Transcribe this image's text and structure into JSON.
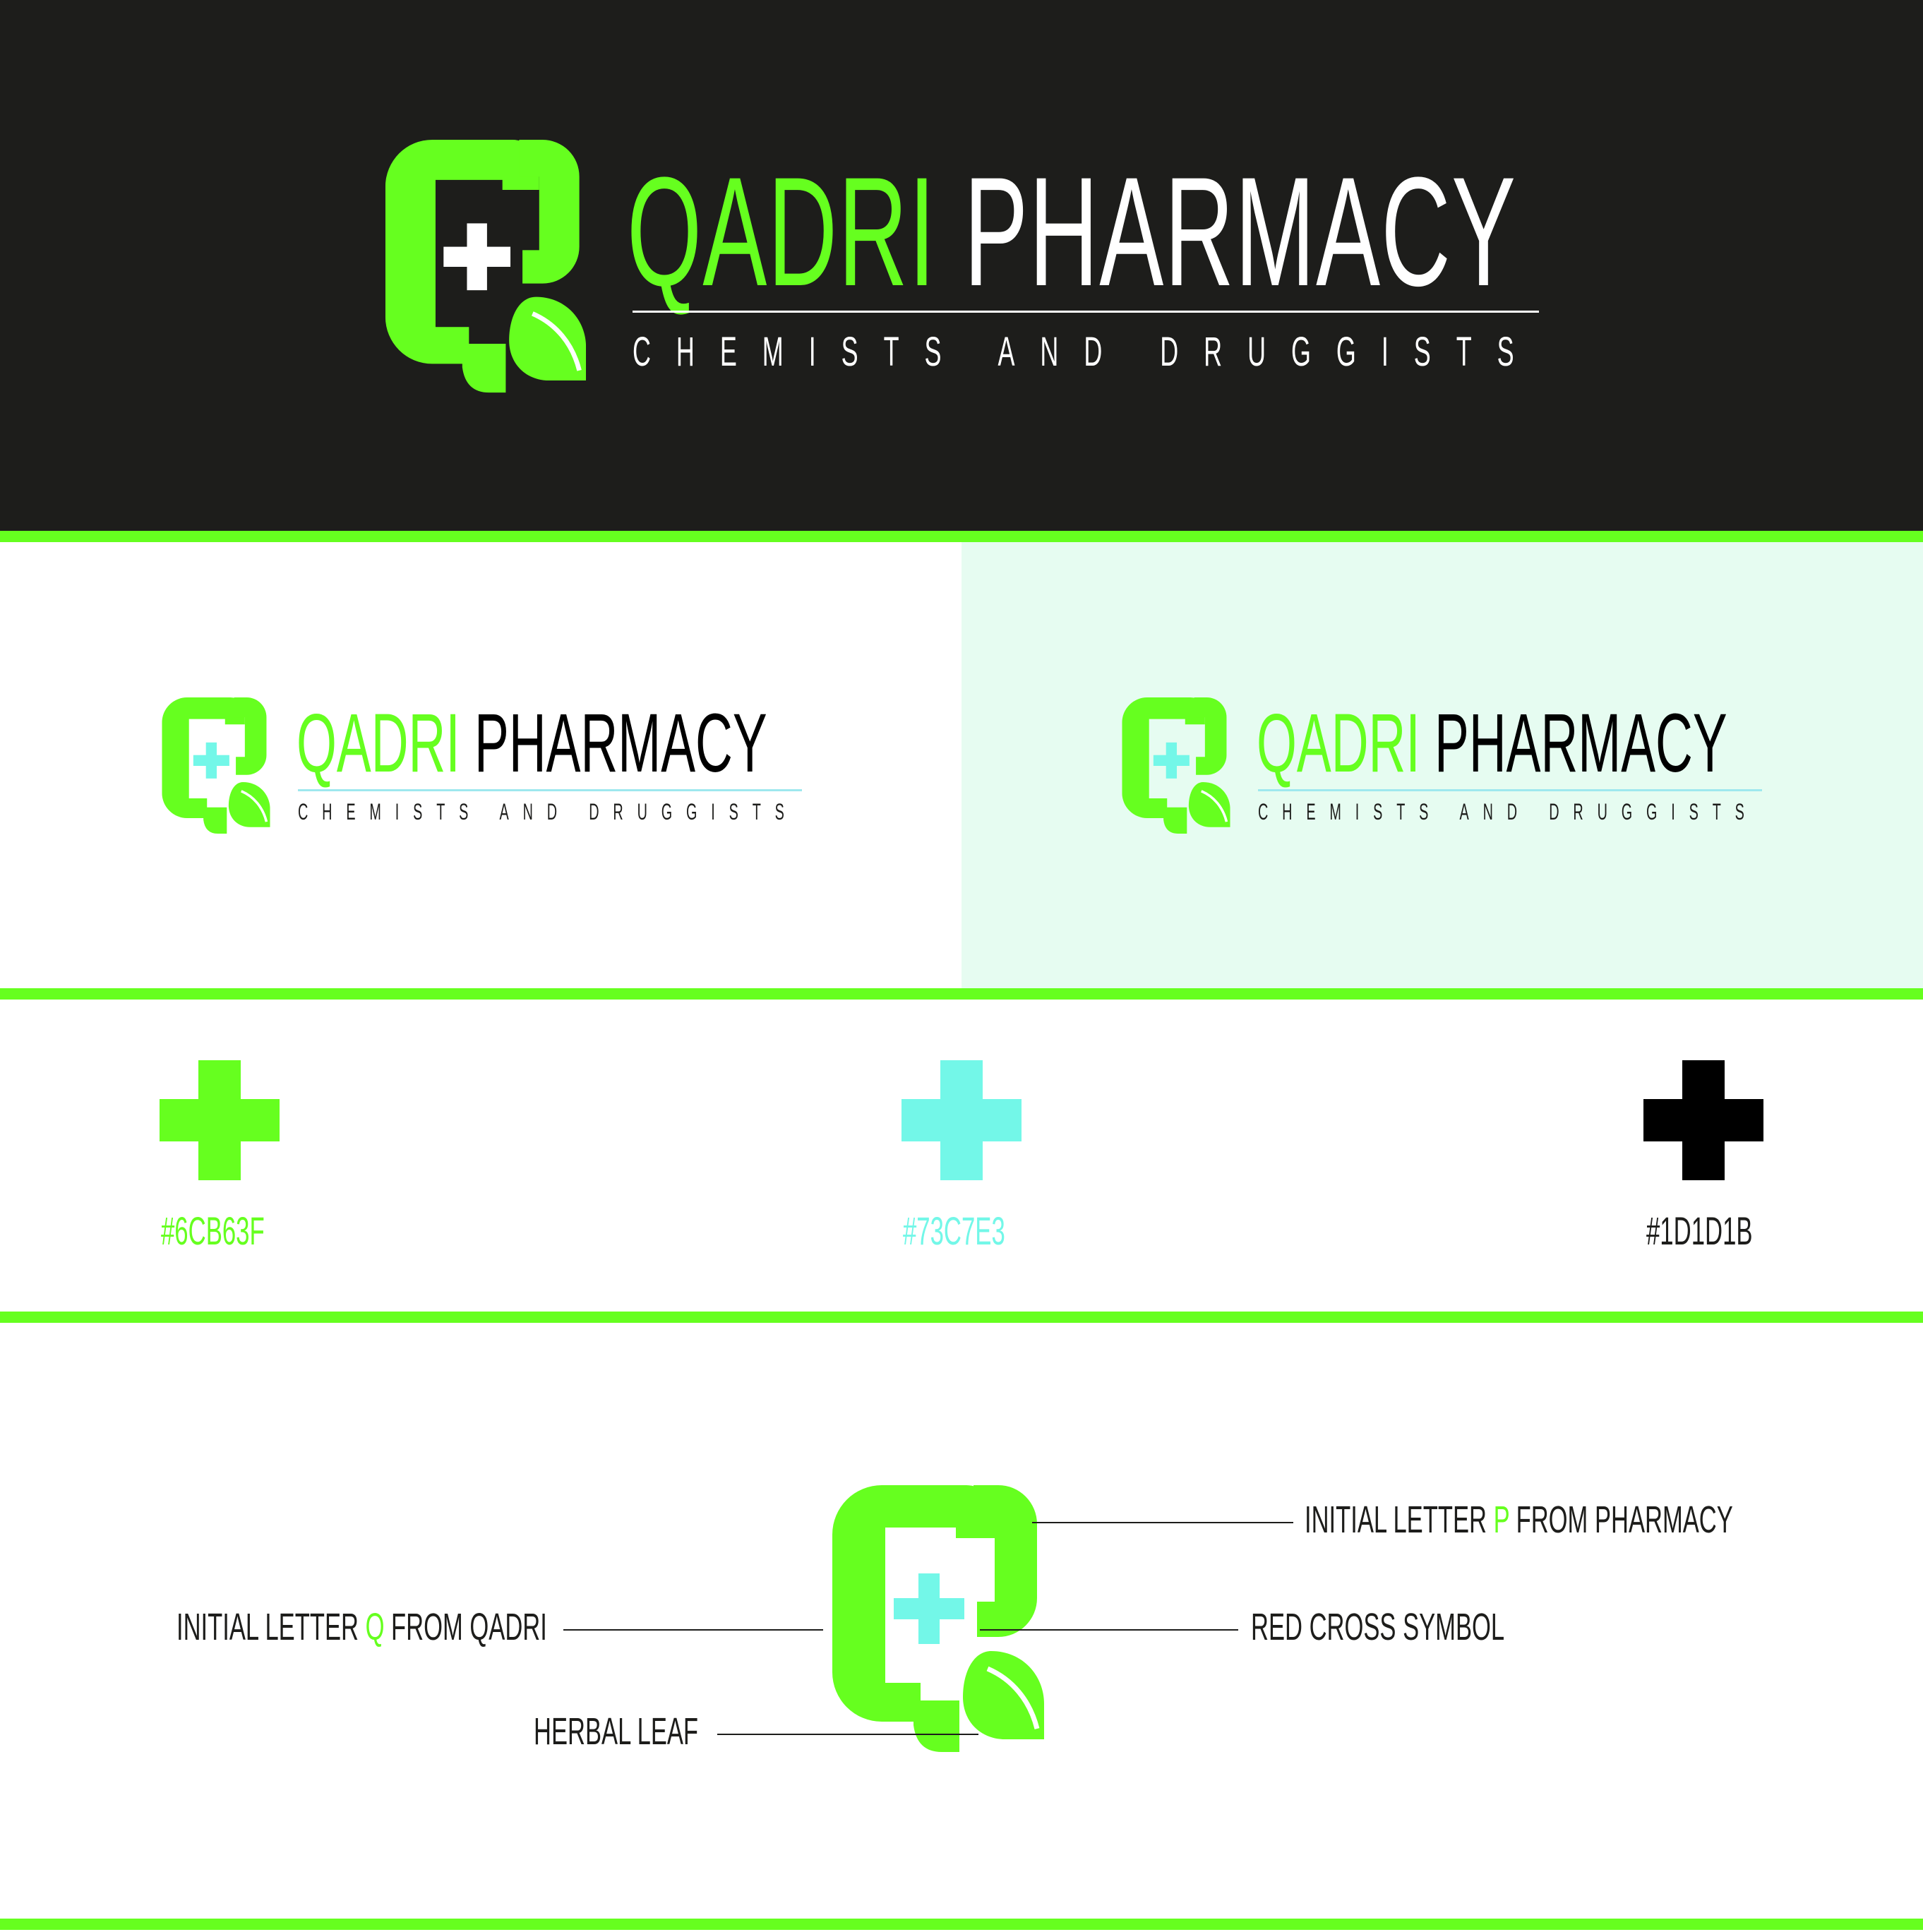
{
  "brand": {
    "name_part1": "QADRI",
    "name_part2": "PHARMACY",
    "tagline": "CHEMISTS AND DRUGGISTS",
    "logo_icon": "qp-monogram-cross-leaf"
  },
  "colors": {
    "primary_green": "#6CB63F",
    "accent_cyan": "#73C7E3",
    "dark": "#1D1D1B",
    "panel_mint": "#E6FCF1"
  },
  "swatches": [
    {
      "icon": "plus-icon",
      "hex": "#6CB63F"
    },
    {
      "icon": "plus-icon",
      "hex": "#73C7E3"
    },
    {
      "icon": "plus-icon",
      "hex": "#1D1D1B"
    }
  ],
  "annotations": {
    "p_letter": {
      "prefix": "INITIAL LETTER ",
      "highlight": "P",
      "suffix": " FROM PHARMACY"
    },
    "q_letter": {
      "prefix": "INITIAL LETTER ",
      "highlight": "Q",
      "suffix": " FROM QADRI"
    },
    "cross": "RED CROSS SYMBOL",
    "leaf": "HERBAL LEAF"
  }
}
